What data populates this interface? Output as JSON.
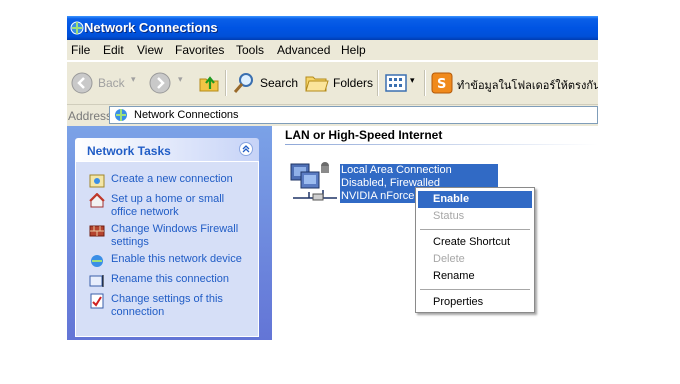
{
  "window": {
    "title": "Network Connections",
    "icon": "network-connections-icon"
  },
  "menu": [
    "File",
    "Edit",
    "View",
    "Favorites",
    "Tools",
    "Advanced",
    "Help"
  ],
  "toolbar": {
    "back_label": "Back",
    "search_label": "Search",
    "folders_label": "Folders",
    "sync_label": "ทำข้อมูลในโฟลเดอร์ให้ตรงกัน"
  },
  "address": {
    "label": "Address",
    "value": "Network Connections"
  },
  "tasks": {
    "title": "Network Tasks",
    "items": [
      {
        "label": "Create a new connection",
        "icon": "new-connection-icon"
      },
      {
        "label": "Set up a home or small office network",
        "icon": "home-network-icon"
      },
      {
        "label": "Change Windows Firewall settings",
        "icon": "firewall-icon"
      },
      {
        "label": "Enable this network device",
        "icon": "enable-device-icon"
      },
      {
        "label": "Rename this connection",
        "icon": "rename-icon"
      },
      {
        "label": "Change settings of this connection",
        "icon": "settings-icon"
      }
    ]
  },
  "main": {
    "group_title": "LAN or High-Speed Internet",
    "connection": {
      "name": "Local Area Connection",
      "status": "Disabled, Firewalled",
      "device": "NVIDIA nForce"
    }
  },
  "context_menu": {
    "items": [
      {
        "label": "Enable",
        "state": "selected"
      },
      {
        "label": "Status",
        "state": "disabled"
      },
      {
        "label": "Create Shortcut",
        "state": "normal"
      },
      {
        "label": "Delete",
        "state": "disabled"
      },
      {
        "label": "Rename",
        "state": "normal"
      },
      {
        "label": "Properties",
        "state": "normal"
      }
    ]
  },
  "colors": {
    "title_blue": "#0054e3",
    "task_link": "#215dc6",
    "selection": "#316ac5"
  }
}
